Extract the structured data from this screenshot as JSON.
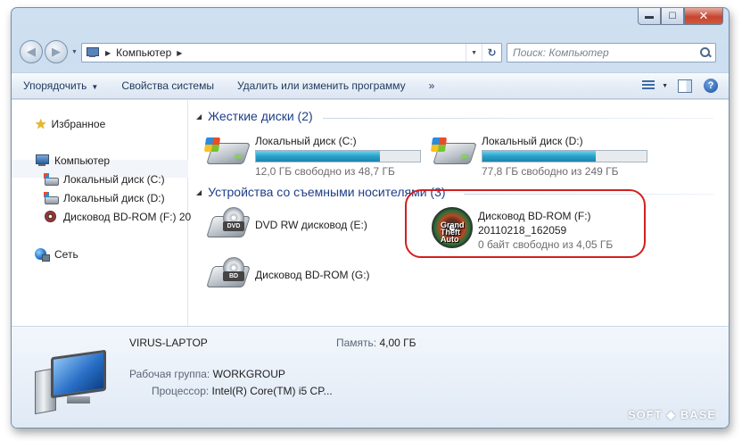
{
  "address_bar": {
    "path": [
      "Компьютер"
    ]
  },
  "search": {
    "placeholder": "Поиск: Компьютер"
  },
  "toolbar": {
    "organize": "Упорядочить",
    "system_properties": "Свойства системы",
    "uninstall": "Удалить или изменить программу",
    "more": "»"
  },
  "sidebar": {
    "favorites": "Избранное",
    "computer": "Компьютер",
    "drives": [
      {
        "label": "Локальный диск (C:)"
      },
      {
        "label": "Локальный диск (D:)"
      },
      {
        "label": "Дисковод BD-ROM (F:) 20"
      }
    ],
    "network": "Сеть"
  },
  "groups": {
    "hard_disks": "Жесткие диски (2)",
    "removable": "Устройства со съемными носителями (3)"
  },
  "hard_disks": [
    {
      "name": "Локальный диск (C:)",
      "free_text": "12,0 ГБ свободно из 48,7 ГБ",
      "used_fraction": 0.754
    },
    {
      "name": "Локальный диск (D:)",
      "free_text": "77,8 ГБ свободно из 249 ГБ",
      "used_fraction": 0.688
    }
  ],
  "removable": [
    {
      "name": "DVD RW дисковод (E:)",
      "badge": "DVD"
    },
    {
      "name": "Дисковод BD-ROM (G:)",
      "badge": "BD"
    },
    {
      "name": "Дисковод BD-ROM (F:)",
      "label": "20110218_162059",
      "free_text": "0 байт свободно из 4,05 ГБ",
      "disc_text": "Grand Theft Auto"
    }
  ],
  "details": {
    "computer_name": "VIRUS-LAPTOP",
    "memory_label": "Память:",
    "memory_value": "4,00 ГБ",
    "workgroup_label": "Рабочая группа:",
    "workgroup_value": "WORKGROUP",
    "cpu_label": "Процессор:",
    "cpu_value": "Intel(R) Core(TM) i5 CP..."
  },
  "watermark": "SOFT ◆ BASE",
  "colors": {
    "accent_link": "#1e3e87",
    "usage_bar": "#29a2c9",
    "highlight": "#d21f1f"
  }
}
